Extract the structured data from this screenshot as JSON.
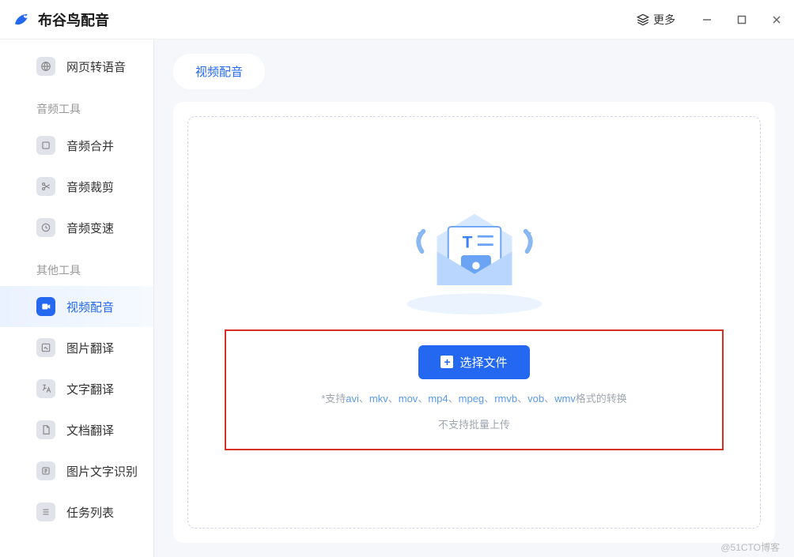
{
  "app": {
    "title": "布谷鸟配音",
    "more": "更多"
  },
  "sidebar": {
    "items": [
      {
        "label": "网页转语音",
        "icon": "globe"
      }
    ],
    "section_audio": "音频工具",
    "audio_items": [
      {
        "label": "音频合并",
        "icon": "merge"
      },
      {
        "label": "音频裁剪",
        "icon": "scissors"
      },
      {
        "label": "音频变速",
        "icon": "speed"
      }
    ],
    "section_other": "其他工具",
    "other_items": [
      {
        "label": "视频配音",
        "icon": "video",
        "active": true
      },
      {
        "label": "图片翻译",
        "icon": "image-translate"
      },
      {
        "label": "文字翻译",
        "icon": "text-translate"
      },
      {
        "label": "文档翻译",
        "icon": "doc-translate"
      },
      {
        "label": "图片文字识别",
        "icon": "ocr"
      },
      {
        "label": "任务列表",
        "icon": "tasks"
      }
    ]
  },
  "tab": {
    "label": "视频配音"
  },
  "upload": {
    "button": "选择文件",
    "support_prefix": "*支持",
    "formats": [
      "avi",
      "mkv",
      "mov",
      "mp4",
      "mpeg",
      "rmvb",
      "vob",
      "wmv"
    ],
    "support_suffix": "格式的转换",
    "no_batch": "不支持批量上传"
  },
  "watermark": "@51CTO博客"
}
